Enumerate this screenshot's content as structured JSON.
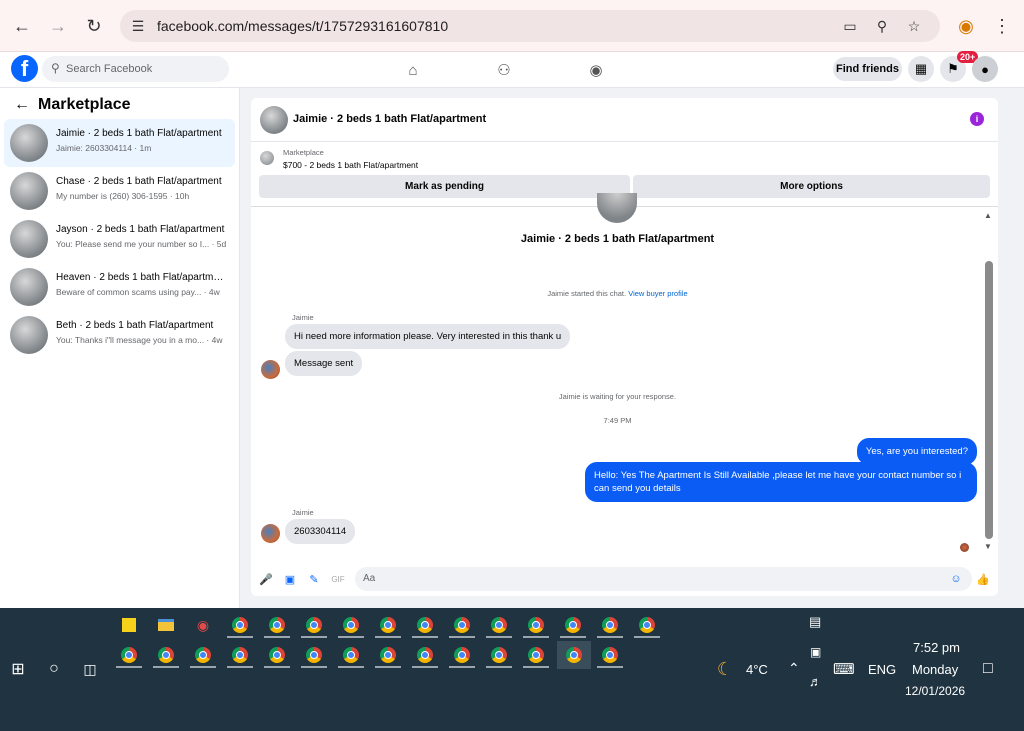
{
  "browser": {
    "url": "facebook.com/messages/t/1757293161607810"
  },
  "fb_header": {
    "search_placeholder": "Search Facebook",
    "find_friends_label": "Find friends",
    "notification_badge": "20+"
  },
  "sidebar": {
    "title": "Marketplace",
    "conversations": [
      {
        "title": "Jaimie · 2 beds 1 bath Flat/apartment",
        "preview": "Jaimie: 2603304114 · 1m",
        "active": true
      },
      {
        "title": "Chase · 2 beds 1 bath Flat/apartment",
        "preview": "My number is (260) 306-1595 · 10h",
        "active": false
      },
      {
        "title": "Jayson · 2 beds 1 bath Flat/apartment",
        "preview": "You: Please send me your number so I... · 5d",
        "active": false
      },
      {
        "title": "Heaven · 2 beds 1 bath Flat/apartment",
        "preview": "Beware of common scams using pay... · 4w",
        "active": false
      },
      {
        "title": "Beth · 2 beds 1 bath Flat/apartment",
        "preview": "You: Thanks i\"ll message you in a mo... · 4w",
        "active": false
      }
    ]
  },
  "chat": {
    "header_title": "Jaimie · 2 beds 1 bath Flat/apartment",
    "marketplace_label": "Marketplace",
    "listing": "$700 - 2 beds 1 bath Flat/apartment",
    "mark_pending_label": "Mark as pending",
    "more_options_label": "More options",
    "top_name": "Jaimie · 2 beds 1 bath Flat/apartment",
    "started_text": "Jaimie started this chat.",
    "view_profile_link": "View buyer profile",
    "sender_1": "Jaimie",
    "msg_in_1": "Hi need more information please. Very interested in this thank u",
    "msg_in_2": "Message sent",
    "waiting_text": "Jaimie is waiting for your response.",
    "time_text": "7:49 PM",
    "msg_out_1": "Yes, are you interested?",
    "msg_out_2": "Hello: Yes The Apartment Is Still Available ,please let me have your contact number so i can send you details",
    "sender_2": "Jaimie",
    "msg_in_3": "2603304114",
    "composer_placeholder": "Aa"
  },
  "taskbar": {
    "weather": "4°C",
    "language": "ENG",
    "time": "7:52 pm",
    "day": "Monday",
    "date": "12/01/2026"
  }
}
